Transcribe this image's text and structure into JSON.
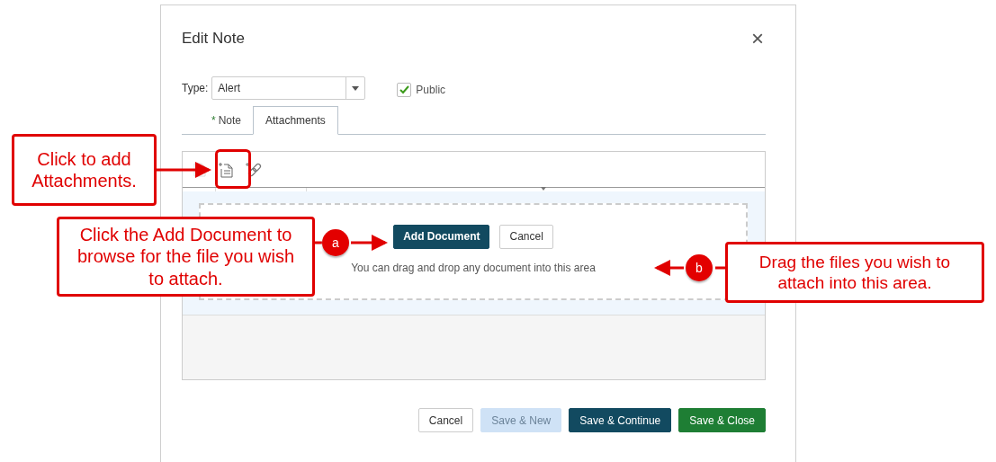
{
  "dialog": {
    "title": "Edit Note",
    "close": "×",
    "type_field": {
      "label": "Type:",
      "value": "Alert"
    },
    "public": {
      "label": "Public",
      "checked": true
    },
    "tabs": [
      {
        "label": "Note",
        "marker": "*",
        "selected": false
      },
      {
        "label": "Attachments",
        "selected": true
      }
    ],
    "drop_zone": {
      "buttons": [
        {
          "label": "Add Document",
          "kind": "primary"
        },
        {
          "label": "Cancel",
          "kind": "outline"
        }
      ],
      "hint": "You can drag and drop any document into this area"
    },
    "footer_buttons": [
      {
        "label": "Cancel",
        "kind": "outline"
      },
      {
        "label": "Save & New",
        "kind": "disabled"
      },
      {
        "label": "Save & Continue",
        "kind": "primary"
      },
      {
        "label": "Save & Close",
        "kind": "success"
      }
    ]
  },
  "callouts": [
    {
      "text": "Click to add Attachments."
    },
    {
      "text": "Click the Add Document to browse for the file you wish to attach.",
      "badge": "a"
    },
    {
      "text": "Drag the files you wish to attach into this area.",
      "badge": "b"
    }
  ]
}
